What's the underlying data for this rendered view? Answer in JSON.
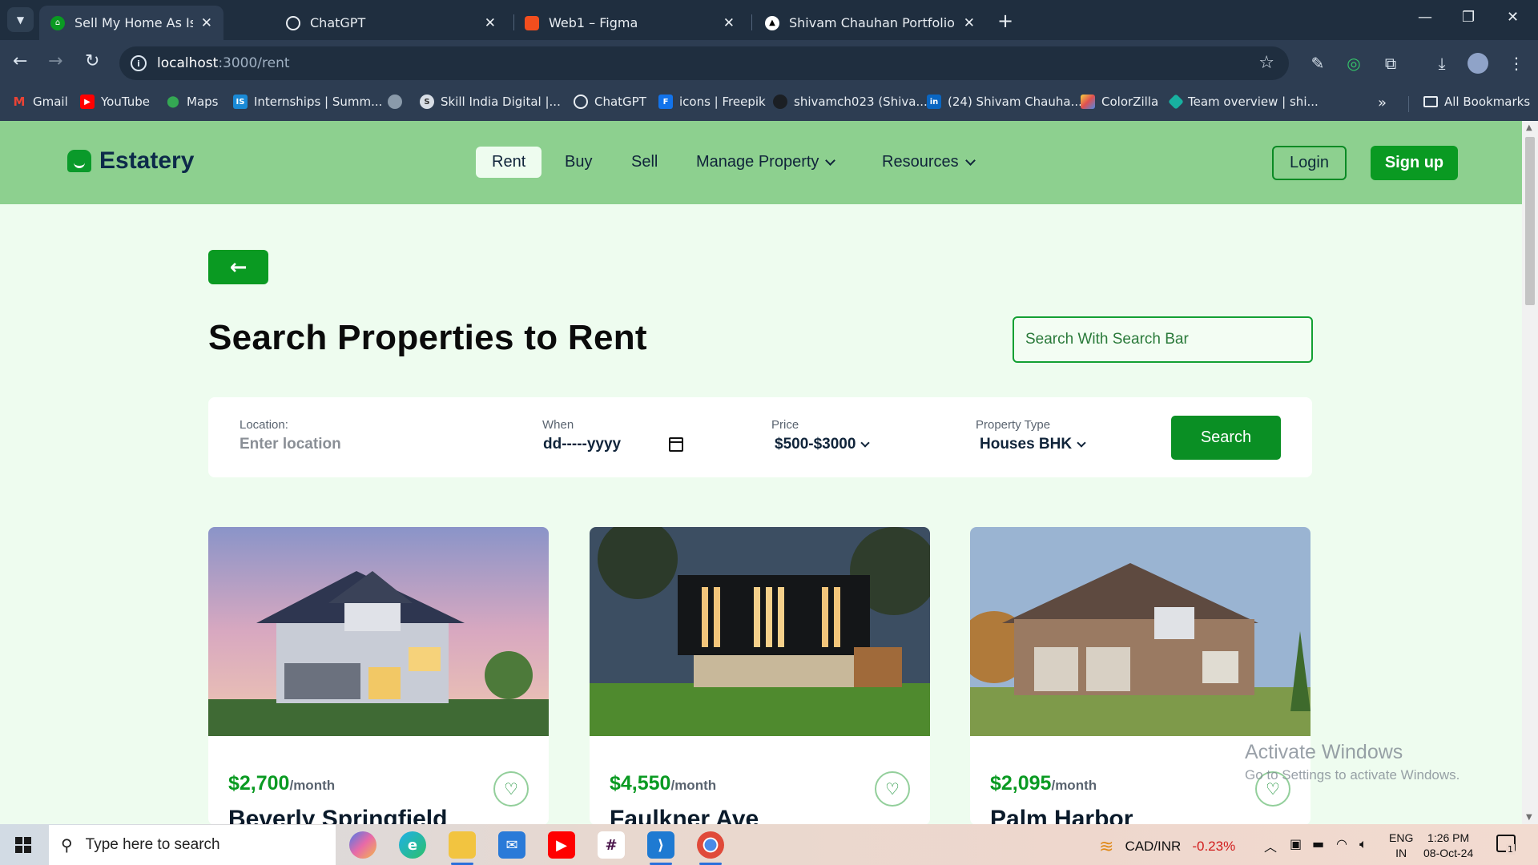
{
  "browser": {
    "tabs": [
      {
        "title": "Sell My Home As Is for Cash in",
        "icon": "estatery-favicon",
        "color": "#0a9a22",
        "active": true
      },
      {
        "title": "ChatGPT",
        "icon": "openai-icon",
        "color": "#ffffff"
      },
      {
        "title": "Web1 – Figma",
        "icon": "figma-icon",
        "color": "#f24e1e"
      },
      {
        "title": "Shivam Chauhan Portfolio",
        "icon": "triangle-icon",
        "color": "#000000"
      }
    ],
    "url_host": "localhost",
    "url_path": ":3000/rent",
    "bookmarks": [
      {
        "label": "Gmail",
        "icon": "gmail-icon",
        "color": "#ea4335"
      },
      {
        "label": "YouTube",
        "icon": "youtube-icon",
        "color": "#ff0000"
      },
      {
        "label": "Maps",
        "icon": "maps-icon",
        "color": "#34a853"
      },
      {
        "label": "Internships | Summ...",
        "icon": "internshala-icon",
        "color": "#1a8ad6"
      },
      {
        "label": "",
        "icon": "globe-icon",
        "color": "#8a9aaa"
      },
      {
        "label": "Skill India Digital |...",
        "icon": "skill-india-icon",
        "color": "#6a7a8a"
      },
      {
        "label": "ChatGPT",
        "icon": "openai-icon",
        "color": "#6a7a8a"
      },
      {
        "label": "icons | Freepik",
        "icon": "freepik-icon",
        "color": "#1273eb"
      },
      {
        "label": "shivamch023 (Shiva...",
        "icon": "github-icon",
        "color": "#1b1f24"
      },
      {
        "label": "(24) Shivam Chauha...",
        "icon": "linkedin-icon",
        "color": "#0a66c2"
      },
      {
        "label": "ColorZilla",
        "icon": "colorzilla-icon",
        "color": "#e05050"
      },
      {
        "label": "Team overview | shi...",
        "icon": "diamond-icon",
        "color": "#18b0a0"
      }
    ],
    "all_bookmarks": "All Bookmarks"
  },
  "site": {
    "brand": "Estatery",
    "brand_color": "#0a9a22",
    "nav": {
      "rent": "Rent",
      "buy": "Buy",
      "sell": "Sell",
      "manage_property": "Manage Property",
      "resources": "Resources"
    },
    "login": "Login",
    "signup": "Sign up"
  },
  "page": {
    "back_icon": "arrow-left-icon",
    "title": "Search Properties to Rent",
    "search_placeholder": "Search With Search Bar",
    "filters": {
      "location_label": "Location:",
      "location_placeholder": "Enter location",
      "when_label": "When",
      "when_value": "dd-----yyyy",
      "price_label": "Price",
      "price_value": "$500-$3000",
      "type_label": "Property Type",
      "type_value": "Houses BHK",
      "search_button": "Search"
    },
    "listings": [
      {
        "price": "$2,700",
        "per": "/month",
        "name": "Beverly Springfield"
      },
      {
        "price": "$4,550",
        "per": "/month",
        "name": "Faulkner Ave"
      },
      {
        "price": "$2,095",
        "per": "/month",
        "name": "Palm Harbor"
      }
    ]
  },
  "watermark": {
    "line1": "Activate Windows",
    "line2": "Go to Settings to activate Windows."
  },
  "taskbar": {
    "search_placeholder": "Type here to search",
    "ticker_pair": "CAD/INR",
    "ticker_change": "-0.23%",
    "lang_top": "ENG",
    "lang_bottom": "IN",
    "time": "1:26 PM",
    "date": "08-Oct-24",
    "notification_count": "1"
  }
}
